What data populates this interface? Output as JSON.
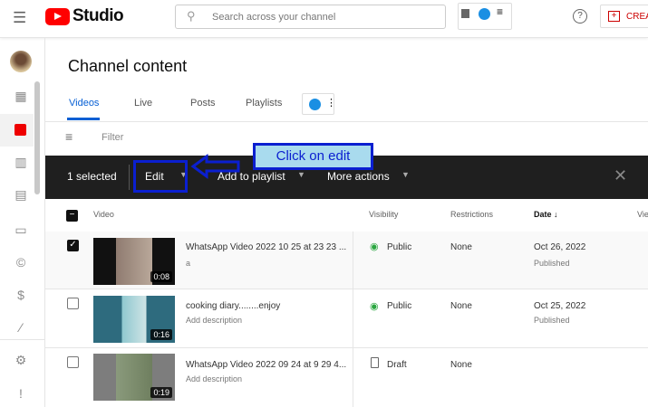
{
  "header": {
    "logo": "Studio",
    "search_placeholder": "Search across your channel",
    "create_label": "CREA"
  },
  "page": {
    "title": "Channel content"
  },
  "tabs": [
    {
      "label": "Videos"
    },
    {
      "label": "Live"
    },
    {
      "label": "Posts"
    },
    {
      "label": "Playlists"
    }
  ],
  "filter": {
    "label": "Filter"
  },
  "selection_bar": {
    "count": "1 selected",
    "edit": "Edit",
    "add_to_playlist": "Add to playlist",
    "more_actions": "More actions"
  },
  "annotation": {
    "text": "Click on edit",
    "color": "#0b1fd0"
  },
  "table": {
    "headers": {
      "video": "Video",
      "visibility": "Visibility",
      "restrictions": "Restrictions",
      "date": "Date ↓",
      "views": "Vie"
    },
    "rows": [
      {
        "title": "WhatsApp Video 2022 10 25 at 23 23 ...",
        "description": "a",
        "duration": "0:08",
        "visibility": "Public",
        "restrictions": "None",
        "date": "Oct 26, 2022",
        "status": "Published",
        "checked": true
      },
      {
        "title": "cooking diary........enjoy",
        "description": "Add description",
        "duration": "0:16",
        "visibility": "Public",
        "restrictions": "None",
        "date": "Oct 25, 2022",
        "status": "Published",
        "checked": false
      },
      {
        "title": "WhatsApp Video 2022 09 24 at 9 29 4...",
        "description": "Add description",
        "duration": "0:19",
        "visibility": "Draft",
        "restrictions": "None",
        "date": "",
        "status": "",
        "checked": false
      }
    ]
  }
}
